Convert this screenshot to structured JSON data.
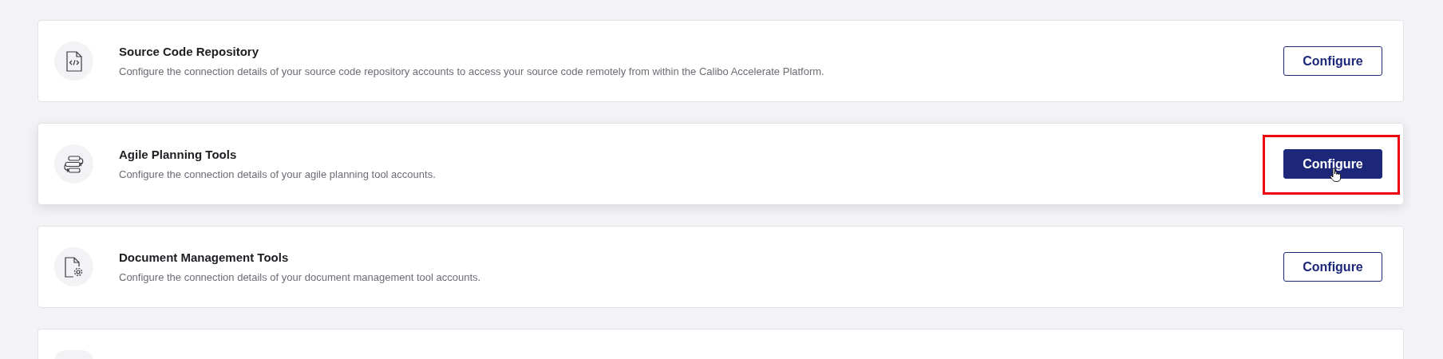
{
  "integrations": [
    {
      "kind": "full",
      "title": "Source Code Repository",
      "description": "Configure the connection details of your source code repository accounts to access your source code remotely from within the Calibo Accelerate Platform.",
      "button": "Configure",
      "hovered": false
    },
    {
      "kind": "full",
      "title": "Agile Planning Tools",
      "description": "Configure the connection details of your agile planning tool accounts.",
      "button": "Configure",
      "hovered": true
    },
    {
      "kind": "full",
      "title": "Document Management Tools",
      "description": "Configure the connection details of your document management tool accounts.",
      "button": "Configure",
      "hovered": false
    },
    {
      "kind": "cut"
    }
  ]
}
